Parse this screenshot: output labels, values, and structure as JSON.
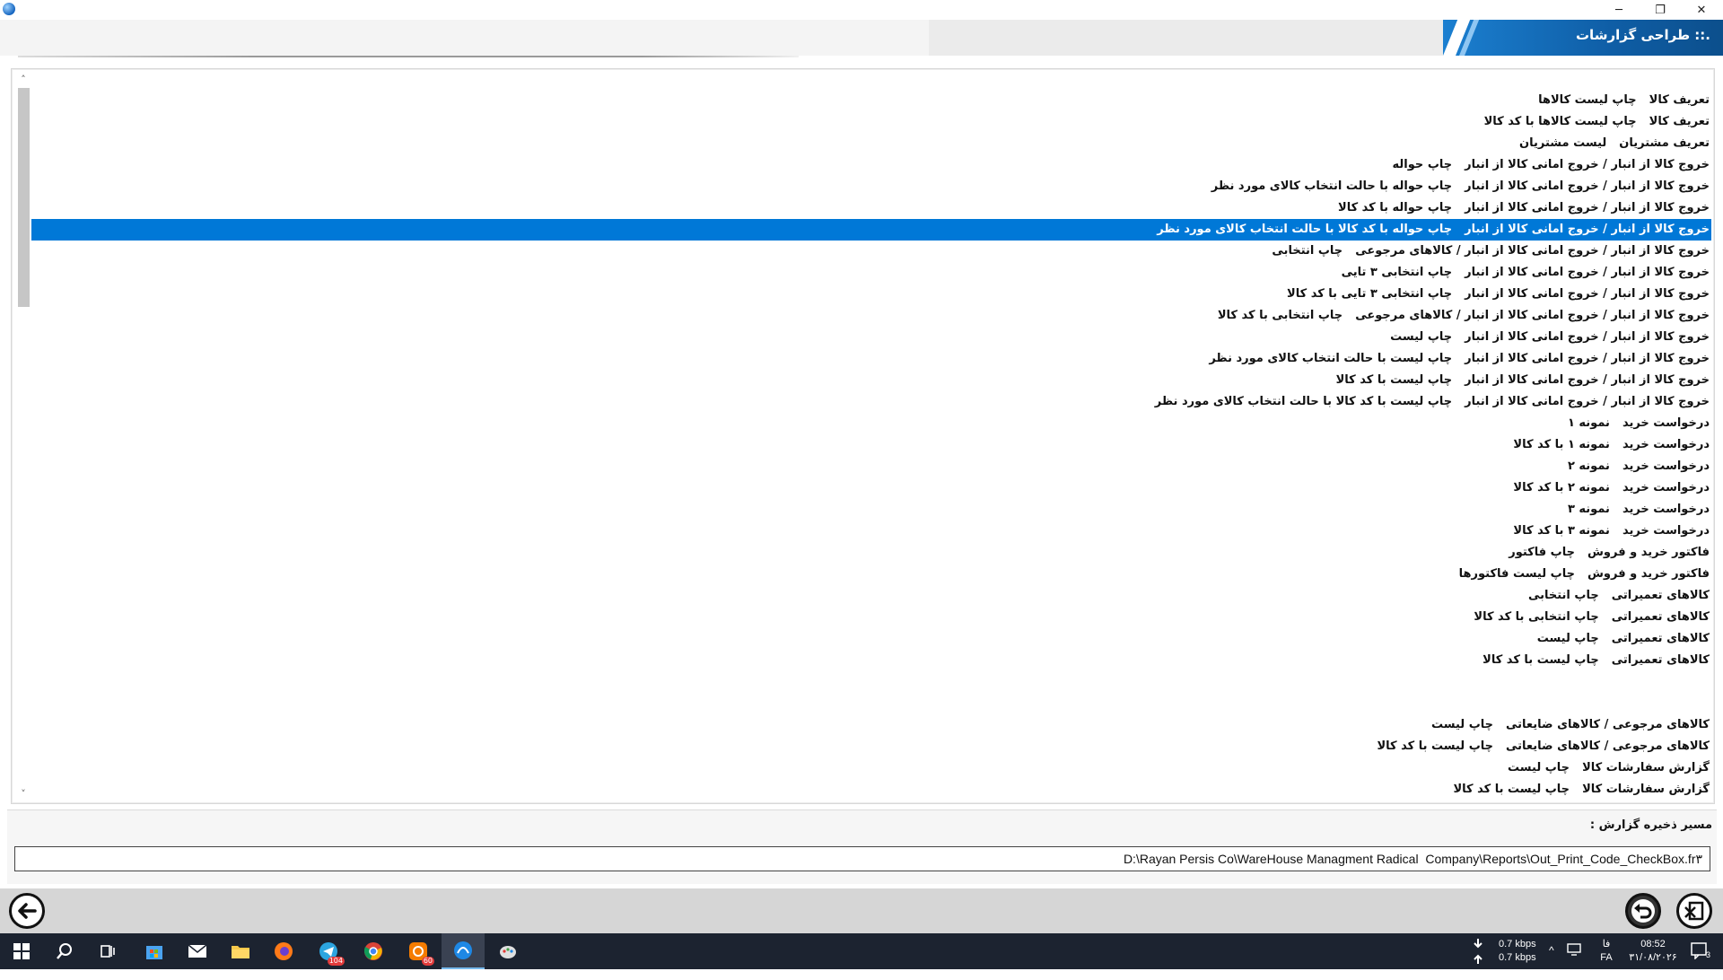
{
  "window": {
    "title": ".:: طراحی گزارشات",
    "minimize": "─",
    "maximize": "❐",
    "close": "✕"
  },
  "report_list": [
    {
      "category": "تعریف کالا",
      "item": "چاپ لیست کالاها"
    },
    {
      "category": "تعریف کالا",
      "item": "چاپ لیست کالاها با کد کالا"
    },
    {
      "category": "تعریف مشتریان",
      "item": "لیست مشتریان"
    },
    {
      "category": "خروج کالا از انبار / خروج امانی کالا از انبار",
      "item": "چاپ حواله"
    },
    {
      "category": "خروج کالا از انبار / خروج امانی کالا از انبار",
      "item": "چاپ حواله با حالت انتخاب کالای مورد نظر"
    },
    {
      "category": "خروج کالا از انبار / خروج امانی کالا از انبار",
      "item": "چاپ حواله با کد کالا"
    },
    {
      "category": "خروج کالا از انبار / خروج امانی کالا از انبار",
      "item": "چاپ حواله با کد کالا با حالت انتخاب کالای مورد نظر",
      "selected": true
    },
    {
      "category": "خروج کالا از انبار / خروج امانی کالا از انبار / کالاهای مرجوعی",
      "item": "چاپ انتخابی"
    },
    {
      "category": "خروج کالا از انبار / خروج امانی کالا از انبار",
      "item": "چاپ انتخابی ۳ تایی"
    },
    {
      "category": "خروج کالا از انبار / خروج امانی کالا از انبار",
      "item": "چاپ انتخابی ۳ تایی با کد کالا"
    },
    {
      "category": "خروج کالا از انبار / خروج امانی کالا از انبار / کالاهای مرجوعی",
      "item": "چاپ انتخابی با کد کالا"
    },
    {
      "category": "خروج کالا از انبار / خروج امانی کالا از انبار",
      "item": "چاپ لیست"
    },
    {
      "category": "خروج کالا از انبار / خروج امانی کالا از انبار",
      "item": "چاپ لیست با حالت انتخاب کالای مورد نظر"
    },
    {
      "category": "خروج کالا از انبار / خروج امانی کالا از انبار",
      "item": "چاپ لیست با کد کالا"
    },
    {
      "category": "خروج کالا از انبار / خروج امانی کالا از انبار",
      "item": "چاپ لیست با کد کالا با حالت انتخاب کالای مورد نظر"
    },
    {
      "category": "درخواست خرید",
      "item": "نمونه ۱"
    },
    {
      "category": "درخواست خرید",
      "item": "نمونه ۱ با کد کالا"
    },
    {
      "category": "درخواست خرید",
      "item": "نمونه ۲"
    },
    {
      "category": "درخواست خرید",
      "item": "نمونه ۲ با کد کالا"
    },
    {
      "category": "درخواست خرید",
      "item": "نمونه ۳"
    },
    {
      "category": "درخواست خرید",
      "item": "نمونه ۳ با کد کالا"
    },
    {
      "category": "فاکتور خرید و فروش",
      "item": "چاپ فاکتور"
    },
    {
      "category": "فاکتور خرید و فروش",
      "item": "چاپ لیست فاکتورها"
    },
    {
      "category": "کالاهای تعمیراتی",
      "item": "چاپ انتخابی"
    },
    {
      "category": "کالاهای تعمیراتی",
      "item": "چاپ انتخابی با کد کالا"
    },
    {
      "category": "کالاهای تعمیراتی",
      "item": "چاپ لیست"
    },
    {
      "category": "کالاهای تعمیراتی",
      "item": "چاپ لیست با کد کالا"
    },
    {
      "category": "",
      "item": ""
    },
    {
      "category": "",
      "item": ""
    },
    {
      "category": "کالاهای مرجوعی / کالاهای ضایعاتی",
      "item": "چاپ لیست"
    },
    {
      "category": "کالاهای مرجوعی / کالاهای ضایعاتی",
      "item": "چاپ لیست با کد کالا"
    },
    {
      "category": "گزارش سفارشات کالا",
      "item": "چاپ لیست"
    },
    {
      "category": "گزارش سفارشات کالا",
      "item": "چاپ لیست با کد کالا"
    }
  ],
  "scrollbar": {
    "up": "˄",
    "down": "˅"
  },
  "save_path": {
    "label": "مسیر ذخیره گزارش :",
    "value": "D:\\Rayan Persis Co\\WareHouse Managment Radical  Company\\Reports\\Out_Print_Code_CheckBox.fr۳"
  },
  "taskbar": {
    "telegram_badge": "104",
    "app_badge": "60",
    "net_down": "0.7 kbps",
    "net_up": "0.7 kbps",
    "lang_top": "فا",
    "lang_bottom": "FA",
    "time": "08:52",
    "date": "۳۱/۰۸/۲۰۲۶",
    "notifications": "3"
  },
  "colors": {
    "selection": "#0078d7",
    "banner": "#0f5ea6",
    "taskbar": "#1c2330"
  }
}
